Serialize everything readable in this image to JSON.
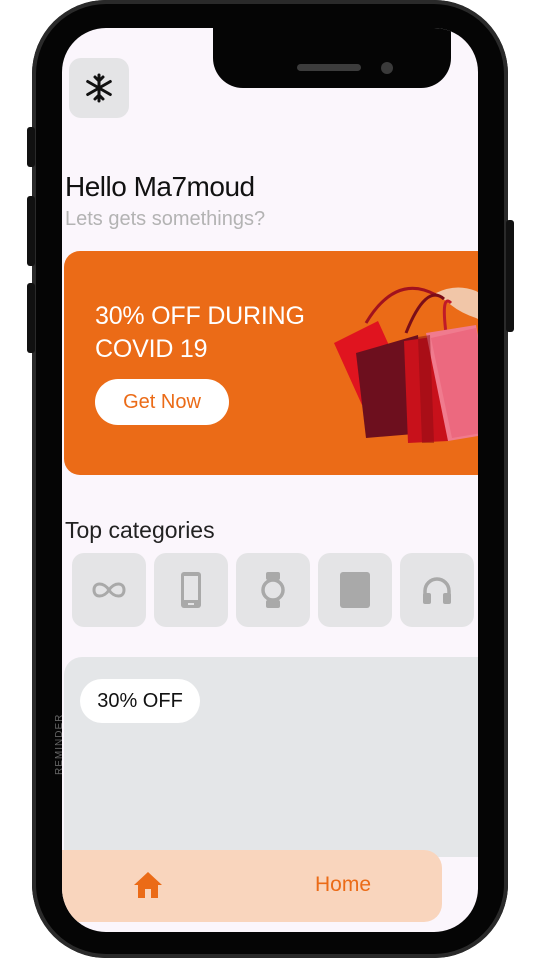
{
  "header": {
    "menu_icon": "snowflake-icon",
    "greeting": "Hello Ma7moud",
    "subtitle": "Lets gets somethings?"
  },
  "promo": {
    "title": "30% OFF DURING COVID 19",
    "button_label": "Get Now",
    "image": "shopping-bags",
    "background_color": "#eb6b17"
  },
  "categories": {
    "title": "Top categories",
    "items": [
      {
        "icon": "infinity-icon"
      },
      {
        "icon": "phone-icon"
      },
      {
        "icon": "watch-icon"
      },
      {
        "icon": "tablet-icon"
      },
      {
        "icon": "headphones-icon"
      }
    ]
  },
  "offer": {
    "badge": "30% OFF",
    "side_label": "REMINDER"
  },
  "bottom_nav": {
    "home_label": "Home",
    "home_icon": "home-icon",
    "accent_color": "#eb6b17"
  }
}
